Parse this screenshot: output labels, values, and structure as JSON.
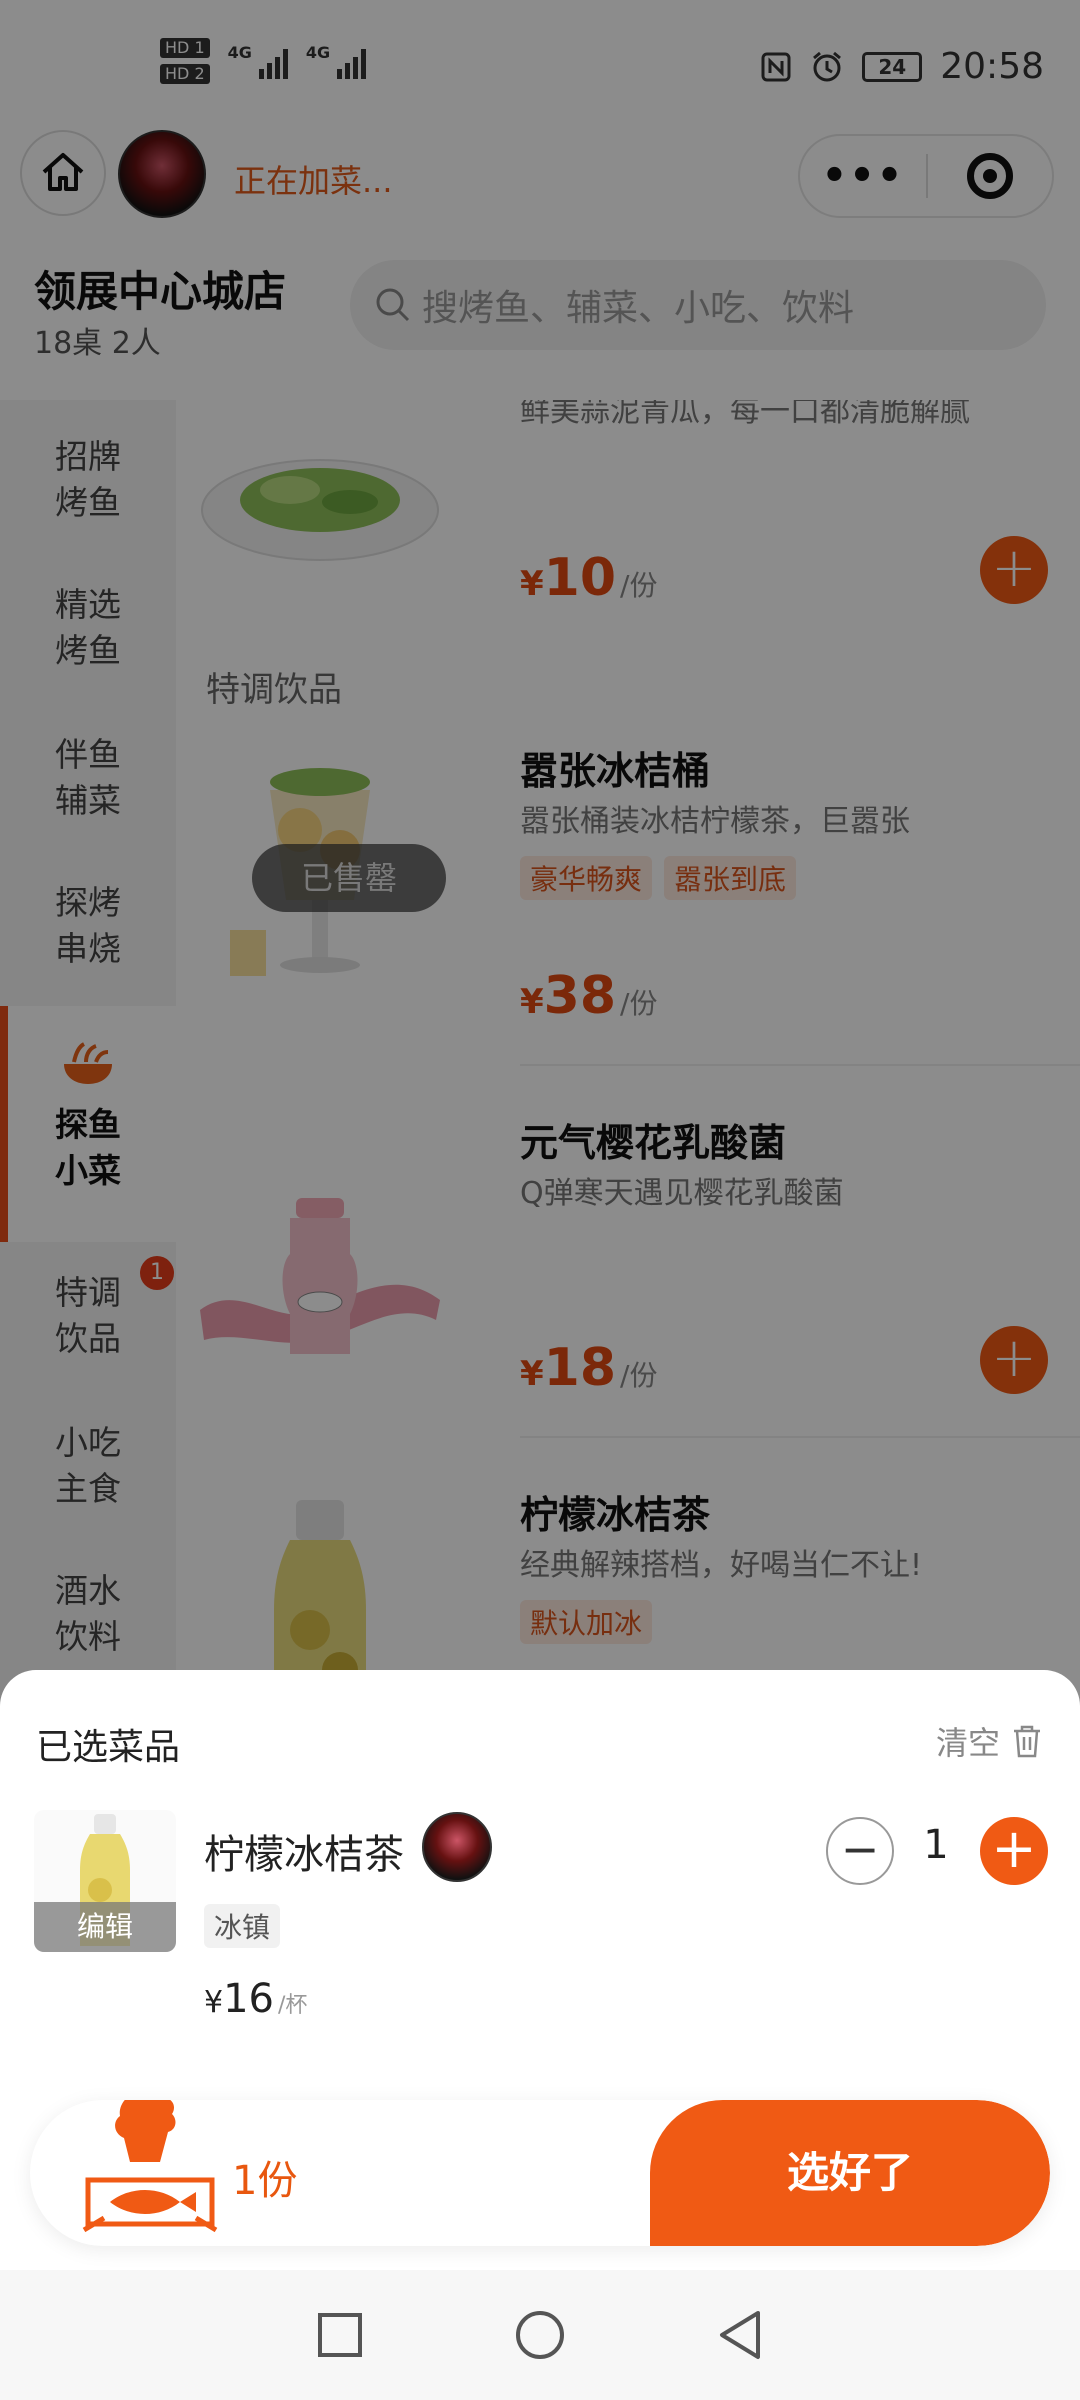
{
  "status_bar": {
    "time": "20:58",
    "battery": "24",
    "network_1": "4G",
    "network_2": "4G",
    "hd_1": "HD 1",
    "hd_2": "HD 2"
  },
  "nav": {
    "status_text": "正在加菜..."
  },
  "store": {
    "name": "领展中心城店",
    "table_info": "18桌  2人",
    "search_placeholder": "搜烤鱼、辅菜、小吃、饮料"
  },
  "sidebar": {
    "items": [
      {
        "line1": "招牌",
        "line2": "烤鱼"
      },
      {
        "line1": "精选",
        "line2": "烤鱼"
      },
      {
        "line1": "伴鱼",
        "line2": "辅菜"
      },
      {
        "line1": "探烤",
        "line2": "串烧"
      },
      {
        "line1": "探鱼",
        "line2": "小菜"
      },
      {
        "line1": "特调",
        "line2": "饮品",
        "badge": "1"
      },
      {
        "line1": "小吃",
        "line2": "主食"
      },
      {
        "line1": "酒水",
        "line2": "饮料"
      }
    ]
  },
  "menu": {
    "top_partial_desc": "鲜美蒜泥青瓜，每一口都清脆解腻",
    "section_drinks": "特调饮品",
    "dishes": [
      {
        "name": "",
        "price": "10",
        "unit": "/份",
        "currency": "¥"
      },
      {
        "name": "嚣张冰桔桶",
        "desc": "嚣张桶装冰桔柠檬茶，巨嚣张",
        "tags": [
          "豪华畅爽",
          "嚣张到底"
        ],
        "price": "38",
        "unit": "/份",
        "currency": "¥",
        "sold_out": "已售罄"
      },
      {
        "name": "元气樱花乳酸菌",
        "desc": "Q弹寒天遇见樱花乳酸菌",
        "price": "18",
        "unit": "/份",
        "currency": "¥"
      },
      {
        "name": "柠檬冰桔茶",
        "desc": "经典解辣搭档，好喝当仁不让!",
        "tags": [
          "默认加冰"
        ]
      }
    ]
  },
  "cart_sheet": {
    "title": "已选菜品",
    "clear_label": "清空",
    "item": {
      "name": "柠檬冰桔茶",
      "edit_label": "编辑",
      "spec": "冰镇",
      "currency": "¥",
      "price": "16",
      "unit": "/杯",
      "quantity": "1"
    }
  },
  "cart_bar": {
    "count": "1份",
    "confirm_label": "选好了"
  },
  "colors": {
    "accent": "#f05a14",
    "price": "#e04a12"
  }
}
